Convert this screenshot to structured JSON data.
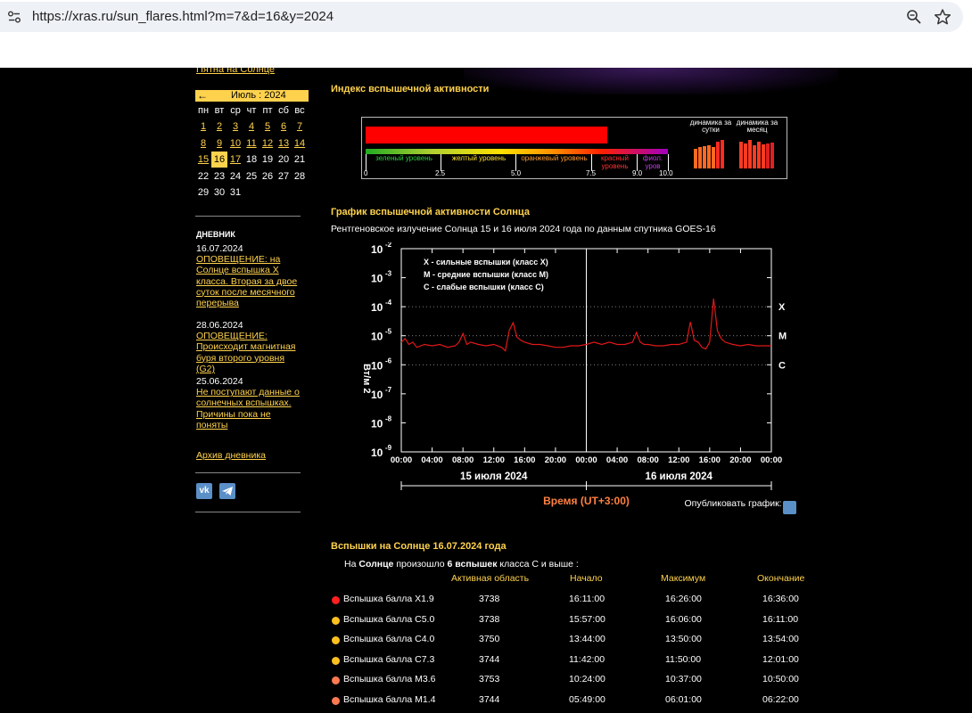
{
  "browser": {
    "url": "https://xras.ru/sun_flares.html?m=7&d=16&y=2024",
    "icons": [
      "site-settings-icon",
      "zoom-icon",
      "star-icon"
    ]
  },
  "sidebar": {
    "top_link": "Пятна на Солнце",
    "calendar": {
      "prev_arrow": "←",
      "month": "Июль : 2024",
      "weekdays": [
        "пн",
        "вт",
        "ср",
        "чт",
        "пт",
        "сб",
        "вс"
      ],
      "days": [
        [
          "1",
          "2",
          "3",
          "4",
          "5",
          "6",
          "7"
        ],
        [
          "8",
          "9",
          "10",
          "11",
          "12",
          "13",
          "14"
        ],
        [
          "15",
          "16",
          "17",
          "18",
          "19",
          "20",
          "21"
        ],
        [
          "22",
          "23",
          "24",
          "25",
          "26",
          "27",
          "28"
        ],
        [
          "29",
          "30",
          "31"
        ]
      ],
      "today": "16"
    },
    "diary_title": "ДНЕВНИК",
    "diary": [
      {
        "date": "16.07.2024",
        "lines": [
          "ОПОВЕЩЕНИЕ: на",
          "Солнце вспышка X",
          "класса. Вторая за двое",
          "суток после месячного",
          "перерыва"
        ]
      },
      {
        "date": "28.06.2024",
        "lines": [
          "ОПОВЕЩЕНИЕ:",
          "Происходит магнитная",
          "буря второго уровня",
          "(G2)"
        ]
      },
      {
        "date": "25.06.2024",
        "lines": [
          "Не поступают данные о",
          "солнечных вспышках.",
          "Причины пока не",
          "поняты"
        ]
      }
    ],
    "archive": "Архив дневника",
    "social": [
      {
        "label": "vk",
        "icon": "vk-icon"
      },
      {
        "label": "tg",
        "icon": "telegram-icon"
      }
    ]
  },
  "index": {
    "title": "Индекс вспышечной активности",
    "value": 8.0,
    "levels": [
      "зеленый уровень",
      "желтый уровень",
      "оранжевый уровень",
      "красный уровень",
      "фиол. уров"
    ],
    "ticks": [
      "0",
      "2.5",
      "5.0",
      "7.5",
      "9.0",
      "10.0"
    ],
    "dyn_day": "динамика за сутки",
    "dyn_month": "динамика за месяц"
  },
  "graph": {
    "title": "График вспышечной активности Солнца",
    "subtitle": "Рентгеновское излучение Солнца 15 и 16 июля 2024 года по данным спутника GOES-16",
    "legend": [
      "X - сильные вспышки (класс X)",
      "M - средние вспышки (класс M)",
      "C - слабые вспышки (класс C)"
    ],
    "ylabel": "Вт/м 2",
    "yticks": [
      "10",
      "10",
      "10",
      "10",
      "10",
      "10",
      "10",
      "10"
    ],
    "yexp": [
      "-2",
      "-3",
      "-4",
      "-5",
      "-6",
      "-7",
      "-8",
      "-9"
    ],
    "xticks": [
      "00:00",
      "04:00",
      "08:00",
      "12:00",
      "16:00",
      "20:00",
      "00:00",
      "04:00",
      "08:00",
      "12:00",
      "16:00",
      "20:00",
      "00:00"
    ],
    "classes": [
      "X",
      "M",
      "C"
    ],
    "day1": "15 июля 2024",
    "day2": "16 июля 2024",
    "xlabel": "Время (UT+3:00)",
    "publish": "Опубликовать график:"
  },
  "chart_data": {
    "type": "line",
    "ylabel": "Вт/м 2",
    "xlabel": "Время (UT+3:00)",
    "yscale": "log",
    "ylim": [
      1e-09,
      0.01
    ],
    "x_unit": "hours from 15.07.2024 00:00",
    "xlim": [
      0,
      48
    ],
    "series": [
      {
        "x": [
          0,
          0.5,
          1,
          1.5,
          2,
          3,
          4,
          5,
          6,
          7,
          7.5,
          8,
          8.5,
          9,
          10,
          11,
          12,
          13,
          13.5,
          14,
          14.5,
          15,
          15.5,
          16,
          17,
          18,
          19,
          20,
          21,
          22,
          23,
          24,
          25,
          26,
          27,
          28,
          29,
          30,
          30.5,
          31,
          31.5,
          32,
          33,
          34,
          35,
          36,
          37,
          37.5,
          38,
          38.5,
          39,
          39.5,
          40,
          40.5,
          41,
          41.5,
          42,
          43,
          44,
          45,
          46,
          47,
          48
        ],
        "y": [
          6e-06,
          8e-06,
          5e-06,
          6e-06,
          4e-06,
          5e-06,
          4.5e-06,
          5e-06,
          4e-06,
          4.5e-06,
          6e-06,
          1.2e-05,
          5e-06,
          6e-06,
          5e-06,
          4.5e-06,
          5e-06,
          4e-06,
          3e-06,
          1.5e-05,
          2.8e-05,
          9e-06,
          7e-06,
          6e-06,
          5e-06,
          5e-06,
          4.5e-06,
          4e-06,
          4e-06,
          4.5e-06,
          4.5e-06,
          5e-06,
          6e-06,
          5e-06,
          6e-06,
          5e-06,
          5e-06,
          6e-06,
          1.3e-05,
          6e-06,
          5e-06,
          5e-06,
          4.5e-06,
          4.5e-06,
          5e-06,
          5e-06,
          6e-06,
          3e-05,
          7e-06,
          6e-06,
          4e-06,
          3.5e-06,
          6e-06,
          0.00019,
          1.5e-05,
          8e-06,
          6e-06,
          5e-06,
          4.5e-06,
          5e-06,
          4.5e-06,
          4.5e-06,
          4.5e-06
        ]
      }
    ]
  },
  "flares": {
    "title": "Вспышки на Солнце 16.07.2024 года",
    "summary_pre": "На",
    "summary_sun": "Солнце",
    "summary_mid": "произошло",
    "summary_count": "6 вспышек",
    "summary_post": "класса C и выше :",
    "columns": [
      "Активная область",
      "Начало",
      "Максимум",
      "Окончание"
    ],
    "rows": [
      {
        "name": "Вспышка балла X1.9",
        "region": "3738",
        "start": "16:11:00",
        "max": "16:26:00",
        "end": "16:36:00",
        "color": "#ff2020"
      },
      {
        "name": "Вспышка балла C5.0",
        "region": "3738",
        "start": "15:57:00",
        "max": "16:06:00",
        "end": "16:11:00",
        "color": "#ffc020"
      },
      {
        "name": "Вспышка балла C4.0",
        "region": "3750",
        "start": "13:44:00",
        "max": "13:50:00",
        "end": "13:54:00",
        "color": "#ffc020"
      },
      {
        "name": "Вспышка балла C7.3",
        "region": "3744",
        "start": "11:42:00",
        "max": "11:50:00",
        "end": "12:01:00",
        "color": "#ffc020"
      },
      {
        "name": "Вспышка балла M3.6",
        "region": "3753",
        "start": "10:24:00",
        "max": "10:37:00",
        "end": "10:50:00",
        "color": "#ff7a50"
      },
      {
        "name": "Вспышка балла M1.4",
        "region": "3744",
        "start": "05:49:00",
        "max": "06:01:00",
        "end": "06:22:00",
        "color": "#ff7a50"
      }
    ]
  }
}
